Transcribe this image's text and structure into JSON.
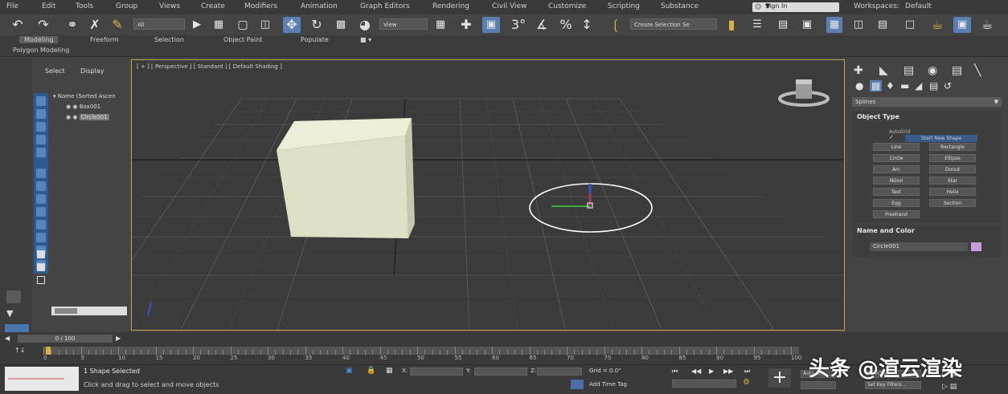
{
  "menu": {
    "items": [
      "File",
      "Edit",
      "Tools",
      "Group",
      "Views",
      "Create",
      "Modifiers",
      "Animation",
      "Graph Editors",
      "Rendering",
      "Civil View",
      "Customize",
      "Scripting",
      "Substance"
    ],
    "workspace_label": "Sign In",
    "right_items": [
      "Workspaces:",
      "Default"
    ]
  },
  "toolbar": {
    "selection_filter": "All",
    "ref_coord": "View",
    "named_selection": "Create Selection Se",
    "snap_angle_label": "3°",
    "percent_label": "%",
    "spinner_label": "↕"
  },
  "ribbon": {
    "tabs": [
      "Modeling",
      "Freeform",
      "Selection",
      "Object Paint",
      "Populate"
    ],
    "active_tab": "Modeling",
    "sub_label": "Polygon Modeling"
  },
  "scene_explorer": {
    "tabs": [
      "Select",
      "Display"
    ],
    "rows": [
      {
        "label": "Name (Sorted Ascen",
        "selected": false
      },
      {
        "label": "Box001",
        "selected": false
      },
      {
        "label": "Circle001",
        "selected": true
      }
    ]
  },
  "viewport": {
    "label": "[ + ] [ Perspective ] [ Standard ] [ Default Shading ]",
    "cube_color": "#dde0c5",
    "border_color": "#c4a155"
  },
  "command_panel": {
    "dropdown": "Splines",
    "object_type": {
      "title": "Object Type",
      "autogrid": "AutoGrid",
      "start_new_shape": "Start New Shape",
      "buttons": [
        "Line",
        "Rectangle",
        "Circle",
        "Ellipse",
        "Arc",
        "Donut",
        "NGon",
        "Star",
        "Text",
        "Helix",
        "Egg",
        "Section",
        "Freehand"
      ]
    },
    "name_and_color": {
      "title": "Name and Color",
      "name": "Circle001",
      "color": "#c79cd8"
    }
  },
  "frame_bar": {
    "counter": "0 / 100"
  },
  "timeline": {
    "ticks": [
      "0",
      "5",
      "10",
      "15",
      "20",
      "25",
      "30",
      "35",
      "40",
      "45",
      "50",
      "55",
      "60",
      "65",
      "70",
      "75",
      "80",
      "85",
      "90",
      "95",
      "100"
    ]
  },
  "status": {
    "selected": "1 Shape Selected",
    "prompt": "Click and drag to select and move objects",
    "grid": "Grid = 0.0\"",
    "add_time_tag": "Add Time Tag",
    "coord_labels": [
      "X:",
      "Y:",
      "Z:"
    ],
    "key_filters": "Set Key Filters...",
    "auto_key": "Auto Key",
    "selected_set": "Selected"
  },
  "watermark": "头条 @渲云渲染",
  "icons": [
    "undo-icon",
    "redo-icon",
    "link-icon",
    "unlink-icon",
    "bind-icon",
    "select-icon",
    "select-by-name-icon",
    "rect-select-icon",
    "window-crossing-icon",
    "move-icon",
    "rotate-icon",
    "scale-icon",
    "placement-icon",
    "snap-icon",
    "angle-snap-icon",
    "percent-snap-icon",
    "spinner-snap-icon",
    "mirror-icon",
    "align-icon",
    "layer-icon",
    "graphite-icon",
    "curve-editor-icon",
    "schematic-icon",
    "material-editor-icon",
    "render-setup-icon",
    "render-frame-icon",
    "render-icon",
    "view-cube-icon",
    "play-icon"
  ]
}
